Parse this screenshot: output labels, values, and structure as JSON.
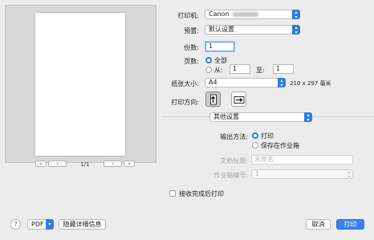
{
  "preview": {
    "page_indicator": "1/1",
    "nav": {
      "first": "«",
      "prev": "‹",
      "next": "›",
      "last": "»"
    }
  },
  "printer": {
    "label": "打印机:",
    "value": "Canon"
  },
  "presets": {
    "label": "预置:",
    "value": "默认设置"
  },
  "copies": {
    "label": "份数:",
    "value": "1"
  },
  "pages": {
    "label": "页数:",
    "all_label": "全部",
    "from_label": "从:",
    "from_value": "1",
    "to_label": "至:",
    "to_value": "1",
    "selected": "all"
  },
  "paper_size": {
    "label": "纸张大小:",
    "value": "A4",
    "dimensions": "210 x 297 毫米"
  },
  "orientation": {
    "label": "打印方向:",
    "selected": "portrait"
  },
  "section_menu": {
    "value": "其他设置"
  },
  "output_method": {
    "label": "输出方法:",
    "options": [
      "打印",
      "保存在作业箱"
    ],
    "selected": "打印"
  },
  "document_title": {
    "label": "文档标题:",
    "placeholder": "未命名"
  },
  "job_box_number": {
    "label": "作业箱编号:",
    "value": "1"
  },
  "print_after_receiving": {
    "label": "接收完成后打印",
    "checked": false
  },
  "footer": {
    "help": "?",
    "pdf_label": "PDF",
    "hide_details": "隐藏详细信息",
    "cancel": "取消",
    "print": "打印"
  },
  "colors": {
    "accent": "#2f7be5",
    "primary_button": "#3b82f0"
  }
}
